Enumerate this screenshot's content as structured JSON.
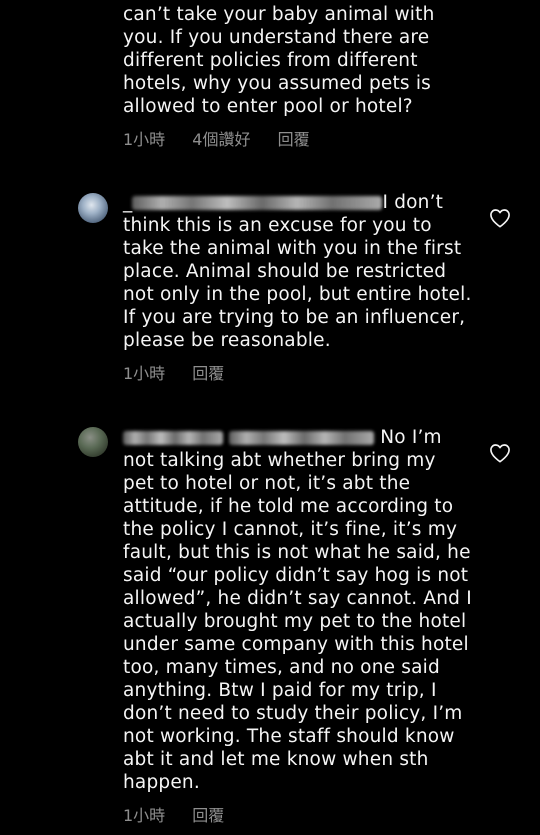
{
  "comments": [
    {
      "lines": [
        "can’t take your baby animal with",
        "you. If you understand there are",
        "different policies from different",
        "hotels, why you assumed pets is",
        "allowed to enter pool or hotel?"
      ],
      "time": "1小時",
      "likes": "4個讚好",
      "reply": "回覆"
    },
    {
      "first_line_prefix": "_",
      "first_line_suffix": "I don’t",
      "lines": [
        "think this is an excuse for you to",
        "take the animal with you in the first",
        "place. Animal should be restricted",
        "not only in the pool, but entire hotel.",
        "If you are trying to be an influencer,",
        "please be reasonable."
      ],
      "time": "1小時",
      "reply": "回覆",
      "like_icon": "heart-outline-icon"
    },
    {
      "first_line_suffix": "No I’m",
      "lines": [
        "not talking abt whether bring my",
        "pet to hotel or not, it’s abt the",
        "attitude, if he told me according to",
        "the policy I cannot, it’s fine, it’s my",
        "fault, but this is not what he said, he",
        "said “our policy didn’t say hog is not",
        "allowed”, he didn’t say cannot. And I",
        "actually brought my pet to the hotel",
        "under same company with this hotel",
        "too, many times, and no one said",
        "anything. Btw I paid for my trip, I",
        "don’t need to study their policy, I’m",
        "not working. The staff should know",
        "abt it and let me know when sth",
        "happen."
      ],
      "time": "1小時",
      "reply": "回覆",
      "like_icon": "heart-outline-icon"
    }
  ],
  "colors": {
    "background": "#000000",
    "text": "#f5f5f5",
    "meta": "#8e8e8e"
  }
}
